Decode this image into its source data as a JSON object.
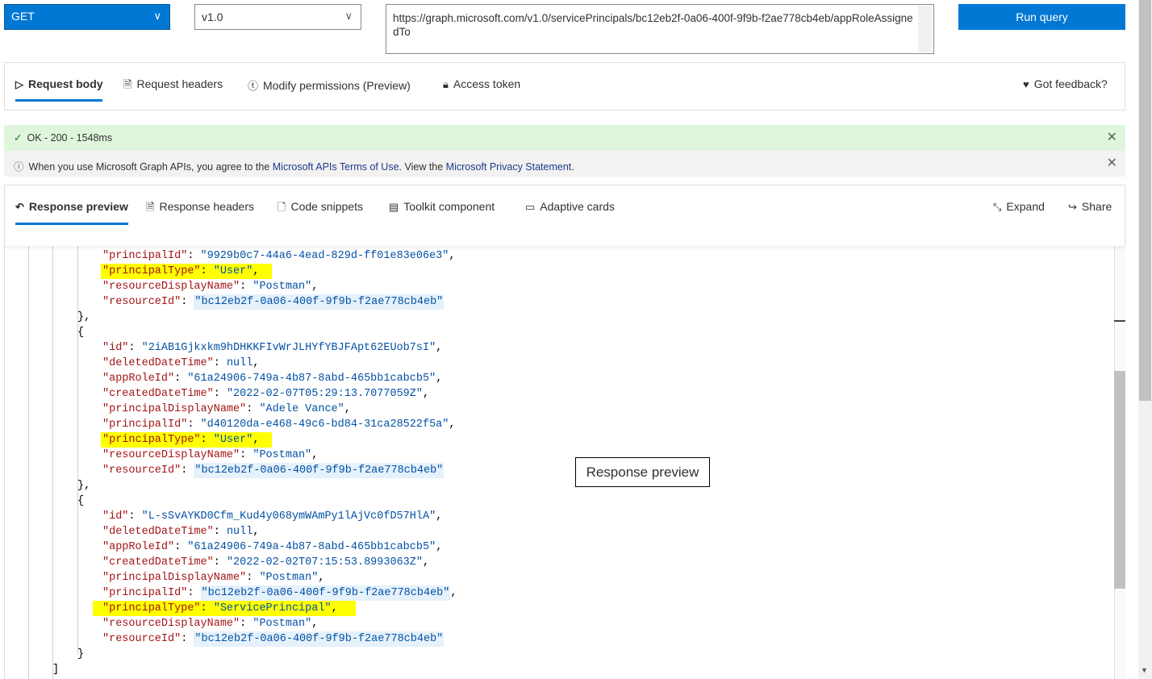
{
  "query": {
    "method": "GET",
    "version": "v1.0",
    "url": "https://graph.microsoft.com/v1.0/servicePrincipals/bc12eb2f-0a06-400f-9f9b-f2ae778cb4eb/appRoleAssignedTo",
    "run_label": "Run query"
  },
  "request_tabs": [
    {
      "label": "Request body",
      "icon": "send-icon",
      "selected": true
    },
    {
      "label": "Request headers",
      "icon": "document-icon"
    },
    {
      "label": "Modify permissions (Preview)",
      "icon": "permissions-icon"
    },
    {
      "label": "Access token",
      "icon": "lock-icon"
    }
  ],
  "feedback_label": "Got feedback?",
  "status": {
    "text": "OK - 200 - 1548ms",
    "color": "#dff6dd"
  },
  "notice": {
    "prefix": "When you use Microsoft Graph APIs, you agree to the ",
    "terms_link": "Microsoft APIs Terms of Use",
    "middle": ". View the ",
    "privacy_link": "Microsoft Privacy Statement",
    "suffix": "."
  },
  "response_tabs": [
    {
      "label": "Response preview",
      "icon": "undo-icon",
      "selected": true
    },
    {
      "label": "Response headers",
      "icon": "document-icon"
    },
    {
      "label": "Code snippets",
      "icon": "code-icon"
    },
    {
      "label": "Toolkit component",
      "icon": "toolkit-icon"
    },
    {
      "label": "Adaptive cards",
      "icon": "card-icon"
    }
  ],
  "response_actions": {
    "expand": "Expand",
    "share": "Share"
  },
  "tooltip": "Response preview",
  "code": {
    "lines": [
      {
        "i": 3,
        "k": "principalId",
        "v": "\"9929b0c7-44a6-4ead-829d-ff01e83e06e3\"",
        "c": ","
      },
      {
        "i": 3,
        "k": "principalType",
        "v": "\"User\"",
        "c": ",",
        "hl": true
      },
      {
        "i": 3,
        "k": "resourceDisplayName",
        "v": "\"Postman\"",
        "c": ","
      },
      {
        "i": 3,
        "k": "resourceId",
        "v": "\"bc12eb2f-0a06-400f-9f9b-f2ae778cb4eb\"",
        "c": "",
        "bhl": true
      },
      {
        "i": 2,
        "t": "},"
      },
      {
        "i": 2,
        "t": "{"
      },
      {
        "i": 3,
        "k": "id",
        "v": "\"2iAB1Gjkxkm9hDHKKFIvWrJLHYfYBJFApt62EUob7sI\"",
        "c": ","
      },
      {
        "i": 3,
        "k": "deletedDateTime",
        "v": "null",
        "c": ","
      },
      {
        "i": 3,
        "k": "appRoleId",
        "v": "\"61a24906-749a-4b87-8abd-465bb1cabcb5\"",
        "c": ","
      },
      {
        "i": 3,
        "k": "createdDateTime",
        "v": "\"2022-02-07T05:29:13.7077059Z\"",
        "c": ","
      },
      {
        "i": 3,
        "k": "principalDisplayName",
        "v": "\"Adele Vance\"",
        "c": ","
      },
      {
        "i": 3,
        "k": "principalId",
        "v": "\"d40120da-e468-49c6-bd84-31ca28522f5a\"",
        "c": ","
      },
      {
        "i": 3,
        "k": "principalType",
        "v": "\"User\"",
        "c": ",",
        "hl": true
      },
      {
        "i": 3,
        "k": "resourceDisplayName",
        "v": "\"Postman\"",
        "c": ","
      },
      {
        "i": 3,
        "k": "resourceId",
        "v": "\"bc12eb2f-0a06-400f-9f9b-f2ae778cb4eb\"",
        "c": "",
        "bhl": true
      },
      {
        "i": 2,
        "t": "},"
      },
      {
        "i": 2,
        "t": "{"
      },
      {
        "i": 3,
        "k": "id",
        "v": "\"L-sSvAYKD0Cfm_Kud4y068ymWAmPy1lAjVc0fD57HlA\"",
        "c": ","
      },
      {
        "i": 3,
        "k": "deletedDateTime",
        "v": "null",
        "c": ","
      },
      {
        "i": 3,
        "k": "appRoleId",
        "v": "\"61a24906-749a-4b87-8abd-465bb1cabcb5\"",
        "c": ","
      },
      {
        "i": 3,
        "k": "createdDateTime",
        "v": "\"2022-02-02T07:15:53.8993063Z\"",
        "c": ","
      },
      {
        "i": 3,
        "k": "principalDisplayName",
        "v": "\"Postman\"",
        "c": ","
      },
      {
        "i": 3,
        "k": "principalId",
        "v": "\"bc12eb2f-0a06-400f-9f9b-f2ae778cb4eb\"",
        "c": ",",
        "bhl": true
      },
      {
        "i": 3,
        "k": "principalType",
        "v": "\"ServicePrincipal\"",
        "c": ",",
        "hl": true
      },
      {
        "i": 3,
        "k": "resourceDisplayName",
        "v": "\"Postman\"",
        "c": ","
      },
      {
        "i": 3,
        "k": "resourceId",
        "v": "\"bc12eb2f-0a06-400f-9f9b-f2ae778cb4eb\"",
        "c": "",
        "bhl": true
      },
      {
        "i": 2,
        "t": "}"
      },
      {
        "i": 1,
        "t": "]"
      }
    ]
  }
}
